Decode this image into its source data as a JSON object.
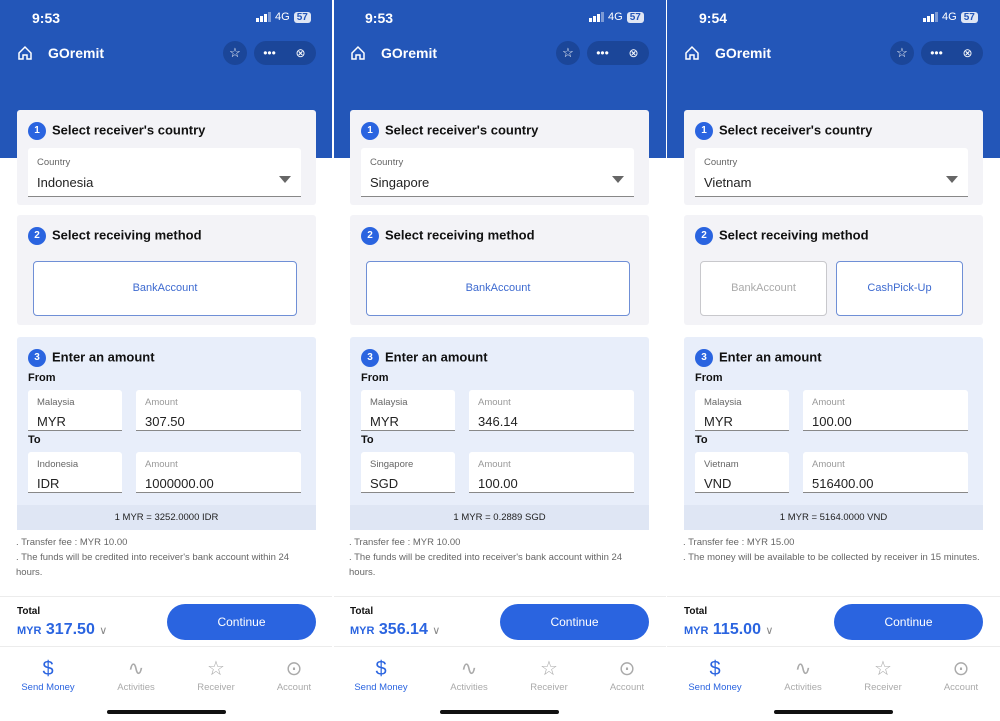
{
  "accent": "#2a64e0",
  "header_color": "#2356b8",
  "phones": [
    {
      "time": "9:53",
      "network": "4G",
      "battery": "57",
      "app_title": "GOremit",
      "step1": "Select receiver's country",
      "country_label": "Country",
      "country": "Indonesia",
      "step2": "Select receiving method",
      "methods": [
        {
          "label1": "Bank",
          "label2": "Account",
          "state": "selected"
        }
      ],
      "step3": "Enter an amount",
      "from": "From",
      "to": "To",
      "from_country": "Malaysia",
      "from_currency": "MYR",
      "amount_label": "Amount",
      "from_amount": "307.50",
      "to_country": "Indonesia",
      "to_currency": "IDR",
      "to_amount": "1000000.00",
      "rate": "1 MYR = 3252.0000 IDR",
      "note1": ". Transfer fee : MYR 10.00",
      "note2": ". The funds will be credited into receiver's bank account within 24 hours.",
      "total_label": "Total",
      "total_currency": "MYR",
      "total_amount": "317.50",
      "continue": "Continue"
    },
    {
      "time": "9:53",
      "network": "4G",
      "battery": "57",
      "app_title": "GOremit",
      "step1": "Select receiver's country",
      "country_label": "Country",
      "country": "Singapore",
      "step2": "Select receiving method",
      "methods": [
        {
          "label1": "Bank",
          "label2": "Account",
          "state": "selected"
        }
      ],
      "step3": "Enter an amount",
      "from": "From",
      "to": "To",
      "from_country": "Malaysia",
      "from_currency": "MYR",
      "amount_label": "Amount",
      "from_amount": "346.14",
      "to_country": "Singapore",
      "to_currency": "SGD",
      "to_amount": "100.00",
      "rate": "1 MYR = 0.2889 SGD",
      "note1": ". Transfer fee : MYR 10.00",
      "note2": ". The funds will be credited into receiver's bank account within 24 hours.",
      "total_label": "Total",
      "total_currency": "MYR",
      "total_amount": "356.14",
      "continue": "Continue"
    },
    {
      "time": "9:54",
      "network": "4G",
      "battery": "57",
      "app_title": "GOremit",
      "step1": "Select receiver's country",
      "country_label": "Country",
      "country": "Vietnam",
      "step2": "Select receiving method",
      "methods": [
        {
          "label1": "Bank",
          "label2": "Account",
          "state": "disabled"
        },
        {
          "label1": "Cash",
          "label2": "Pick-Up",
          "state": "selected"
        }
      ],
      "step3": "Enter an amount",
      "from": "From",
      "to": "To",
      "from_country": "Malaysia",
      "from_currency": "MYR",
      "amount_label": "Amount",
      "from_amount": "100.00",
      "to_country": "Vietnam",
      "to_currency": "VND",
      "to_amount": "516400.00",
      "rate": "1 MYR = 5164.0000 VND",
      "note1": ". Transfer fee : MYR 15.00",
      "note2": ". The money will be available to be collected by receiver in 15 minutes.",
      "total_label": "Total",
      "total_currency": "MYR",
      "total_amount": "115.00",
      "continue": "Continue"
    }
  ],
  "tabs": [
    {
      "label": "Send Money",
      "icon": "dollar-icon",
      "active": true
    },
    {
      "label": "Activities",
      "icon": "activity-icon",
      "active": false
    },
    {
      "label": "Receiver",
      "icon": "star-icon",
      "active": false
    },
    {
      "label": "Account",
      "icon": "user-icon",
      "active": false
    }
  ]
}
